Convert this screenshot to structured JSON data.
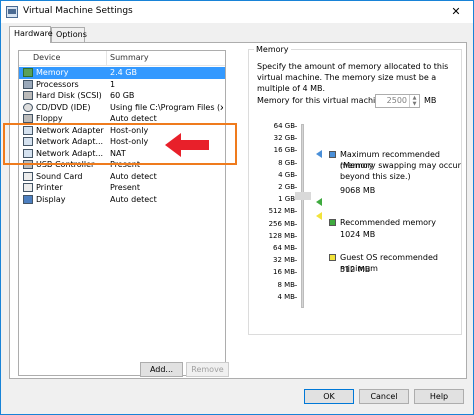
{
  "window": {
    "title": "Virtual Machine Settings",
    "close_glyph": "✕"
  },
  "tabs": [
    {
      "label": "Hardware",
      "active": true
    },
    {
      "label": "Options",
      "active": false
    }
  ],
  "device_list": {
    "columns": {
      "device": "Device",
      "summary": "Summary"
    },
    "rows": [
      {
        "device": "Memory",
        "summary": "2.4 GB",
        "icon": "memory-icon",
        "selected": true
      },
      {
        "device": "Processors",
        "summary": "1",
        "icon": "processor-icon",
        "selected": false
      },
      {
        "device": "Hard Disk (SCSI)",
        "summary": "60 GB",
        "icon": "hard-disk-icon",
        "selected": false
      },
      {
        "device": "CD/DVD (IDE)",
        "summary": "Using file C:\\Program Files (x...",
        "icon": "cd-dvd-icon",
        "selected": false
      },
      {
        "device": "Floppy",
        "summary": "Auto detect",
        "icon": "floppy-icon",
        "selected": false
      },
      {
        "device": "Network Adapter",
        "summary": "Host-only",
        "icon": "network-adapter-icon",
        "selected": false
      },
      {
        "device": "Network Adapt...",
        "summary": "Host-only",
        "icon": "network-adapter-icon",
        "selected": false
      },
      {
        "device": "Network Adapt...",
        "summary": "NAT",
        "icon": "network-adapter-icon",
        "selected": false
      },
      {
        "device": "USB Controller",
        "summary": "Present",
        "icon": "usb-icon",
        "selected": false
      },
      {
        "device": "Sound Card",
        "summary": "Auto detect",
        "icon": "sound-card-icon",
        "selected": false
      },
      {
        "device": "Printer",
        "summary": "Present",
        "icon": "printer-icon",
        "selected": false
      },
      {
        "device": "Display",
        "summary": "Auto detect",
        "icon": "display-icon",
        "selected": false
      }
    ]
  },
  "buttons": {
    "add": "Add...",
    "remove": "Remove",
    "ok": "OK",
    "cancel": "Cancel",
    "help": "Help"
  },
  "memory": {
    "group_title": "Memory",
    "description": "Specify the amount of memory allocated to this virtual machine. The memory size must be a multiple of 4 MB.",
    "field_label": "Memory for this virtual machine:",
    "value": "2500",
    "unit": "MB",
    "scale_labels": [
      "64 GB",
      "32 GB",
      "16 GB",
      "8 GB",
      "4 GB",
      "2 GB",
      "1 GB",
      "512 MB",
      "256 MB",
      "128 MB",
      "64 MB",
      "32 MB",
      "16 MB",
      "8 MB",
      "4 MB"
    ],
    "legend": {
      "max_recommended": {
        "label": "Maximum recommended memory",
        "note": "(Memory swapping may occur beyond this size.)",
        "value": "9068 MB",
        "color": "#4a8fd8"
      },
      "recommended": {
        "label": "Recommended memory",
        "value": "1024 MB",
        "color": "#3faa3f"
      },
      "guest_min": {
        "label": "Guest OS recommended minimum",
        "value": "512 MB",
        "color": "#f2e33b"
      }
    }
  },
  "colors": {
    "selection": "#3399ff",
    "annotation_frame": "#ef7b1d",
    "annotation_arrow": "#e8202a"
  }
}
